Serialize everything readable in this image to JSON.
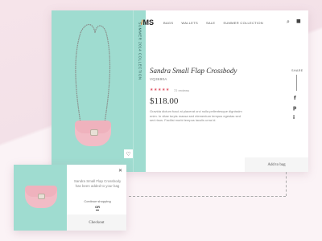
{
  "side_banner": "SUMMER 2014 COLLECTION",
  "logo": {
    "accent": "/",
    "text": "MS"
  },
  "nav": [
    "BAGS",
    "WALLETS",
    "SALE",
    "SUMMER COLLECTION"
  ],
  "icons": {
    "search": "search-icon",
    "bag": "shopping-bag-icon",
    "heart": "heart-icon",
    "close": "close-icon"
  },
  "product": {
    "title": "Sandra Small Flap Crossbody",
    "sku": "VQ3690A",
    "stars": "★★★★★",
    "reviews": "72 reviews",
    "price": "$118.00",
    "description": "Gravida dictum fusci at placerat orci nulla pellentesque dignissim enim. In vitae turpis massa sed elementum tempus egestas sed sed risus. Facilisi morbi tempus iaculis urna id."
  },
  "share": {
    "label": "SHARE",
    "networks": [
      "f",
      "p",
      "i"
    ]
  },
  "add_to_bag": "Add to bag",
  "popup": {
    "message": "Sandra Small Flap Crossbody has been added to your bag",
    "continue": "Continue shopping",
    "or": "OR",
    "checkout": "Checkout"
  },
  "colors": {
    "mint": "#9fdcd0",
    "pink_bag": "#f2bcc6",
    "accent": "#f28a3a",
    "star": "#e05a6b"
  }
}
